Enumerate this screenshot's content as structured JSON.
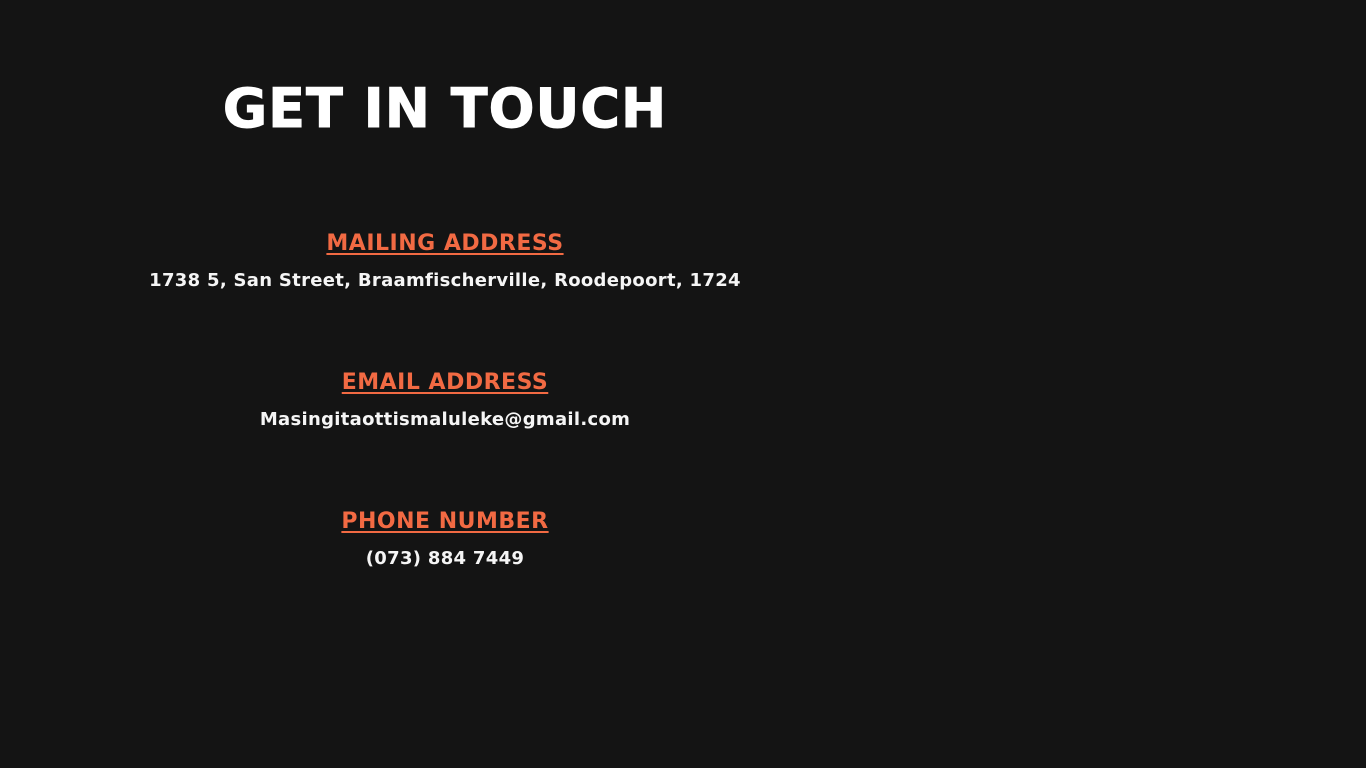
{
  "page": {
    "title": "GET IN TOUCH"
  },
  "contact": {
    "mailing": {
      "heading": "MAILING ADDRESS",
      "value": "1738 5, San Street, Braamfischerville, Roodepoort, 1724"
    },
    "email": {
      "heading": "EMAIL ADDRESS",
      "value": "Masingitaottismaluleke@gmail.com"
    },
    "phone": {
      "heading": "PHONE NUMBER",
      "value": "(073) 884 7449"
    }
  },
  "colors": {
    "background": "#141414",
    "accent": "#f26a43",
    "text": "#f5f5f5"
  }
}
